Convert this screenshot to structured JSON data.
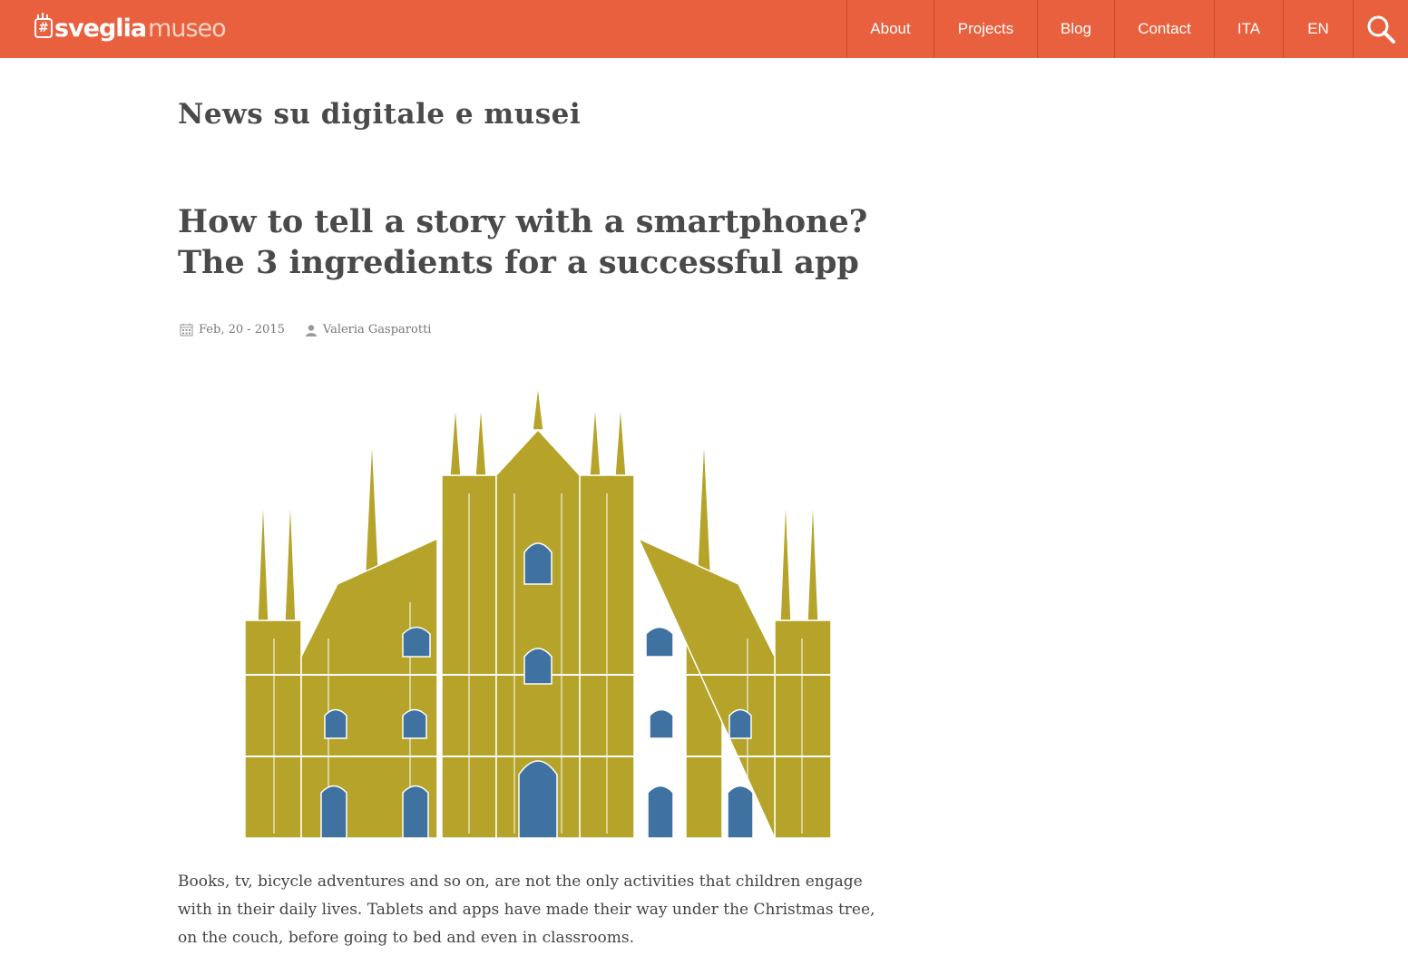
{
  "colors": {
    "brand": "#e8603e",
    "text": "#444444",
    "cathedral_gold": "#b5a32a",
    "window_blue": "#3f72a1"
  },
  "header": {
    "logo_strong": "sveglia",
    "logo_light": "museo",
    "nav": [
      {
        "label": "About"
      },
      {
        "label": "Projects"
      },
      {
        "label": "Blog"
      },
      {
        "label": "Contact"
      },
      {
        "label": "ITA"
      },
      {
        "label": "EN"
      }
    ],
    "search_icon": "search-icon"
  },
  "main": {
    "section_title": "News su digitale e musei",
    "post": {
      "title": "How to tell a story with a smartphone? The 3 ingredients for a successful app",
      "date": "Feb, 20 - 2015",
      "author": "Valeria Gasparotti",
      "date_icon": "calendar-icon",
      "author_icon": "user-icon",
      "image": "illustration of Milan cathedral (Duomo)",
      "paragraph1": "Books, tv, bicycle adventures and so on, are not the only activities that children engage with in their daily lives. Tablets and apps have made their way under the Christmas tree, on the couch, before going to bed and even in classrooms."
    }
  }
}
